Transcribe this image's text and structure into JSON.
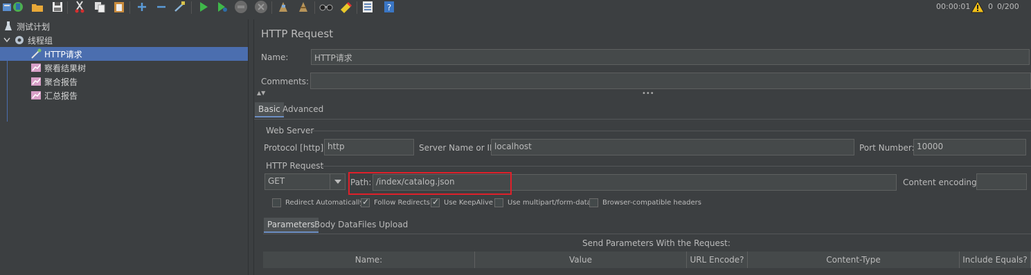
{
  "toolbar": {
    "icons": [
      "templates-icon",
      "open-icon",
      "save-icon",
      "cut-icon",
      "copy-icon",
      "paste-icon",
      "add-icon",
      "remove-icon",
      "toggle-icon",
      "start-icon",
      "start-no-pause-icon",
      "stop-icon",
      "shutdown-icon",
      "clear-icon",
      "clear-all-icon",
      "search-icon",
      "reset-search-icon",
      "function-helper-icon",
      "help-icon"
    ],
    "timer": "00:00:01",
    "error_count": "0",
    "threads": "0/200"
  },
  "tree": {
    "items": [
      {
        "label": "测试计划",
        "icon": "flask-icon"
      },
      {
        "label": "线程组",
        "icon": "gear-icon"
      },
      {
        "label": "HTTP请求",
        "icon": "pipette-icon"
      },
      {
        "label": "察看结果树",
        "icon": "chart-icon"
      },
      {
        "label": "聚合报告",
        "icon": "chart-icon"
      },
      {
        "label": "汇总报告",
        "icon": "chart-icon"
      }
    ]
  },
  "panel": {
    "title": "HTTP Request",
    "name_label": "Name:",
    "name_value": "HTTP请求",
    "comments_label": "Comments:",
    "comments_value": "",
    "tabs": [
      "Basic",
      "Advanced"
    ],
    "web_server": {
      "legend": "Web Server",
      "protocol_label": "Protocol [http]:",
      "protocol_value": "http",
      "server_label": "Server Name or IP:",
      "server_value": "localhost",
      "port_label": "Port Number:",
      "port_value": "10000"
    },
    "http_request": {
      "legend": "HTTP Request",
      "method": "GET",
      "path_label": "Path:",
      "path_value": "/index/catalog.json",
      "encoding_label": "Content encoding:",
      "encoding_value": ""
    },
    "checkboxes": [
      {
        "label": "Redirect Automatically",
        "checked": false
      },
      {
        "label": "Follow Redirects",
        "checked": true
      },
      {
        "label": "Use KeepAlive",
        "checked": true
      },
      {
        "label": "Use multipart/form-data",
        "checked": false
      },
      {
        "label": "Browser-compatible headers",
        "checked": false
      }
    ],
    "sub_tabs": [
      "Parameters",
      "Body Data",
      "Files Upload"
    ],
    "params_caption": "Send Parameters With the Request:",
    "columns": [
      "Name:",
      "Value",
      "URL Encode?",
      "Content-Type",
      "Include Equals?"
    ]
  }
}
